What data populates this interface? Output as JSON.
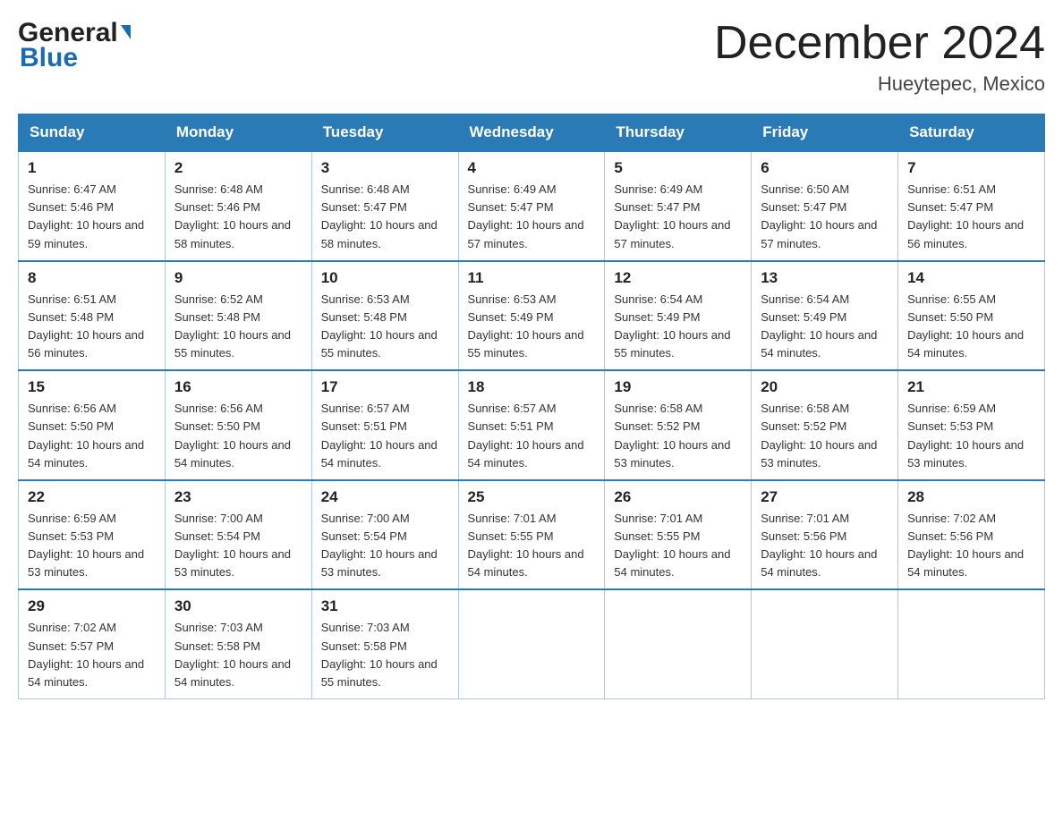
{
  "logo": {
    "general": "General",
    "blue": "Blue"
  },
  "header": {
    "title": "December 2024",
    "subtitle": "Hueytepec, Mexico"
  },
  "columns": [
    "Sunday",
    "Monday",
    "Tuesday",
    "Wednesday",
    "Thursday",
    "Friday",
    "Saturday"
  ],
  "weeks": [
    [
      {
        "day": "1",
        "sunrise": "Sunrise: 6:47 AM",
        "sunset": "Sunset: 5:46 PM",
        "daylight": "Daylight: 10 hours and 59 minutes."
      },
      {
        "day": "2",
        "sunrise": "Sunrise: 6:48 AM",
        "sunset": "Sunset: 5:46 PM",
        "daylight": "Daylight: 10 hours and 58 minutes."
      },
      {
        "day": "3",
        "sunrise": "Sunrise: 6:48 AM",
        "sunset": "Sunset: 5:47 PM",
        "daylight": "Daylight: 10 hours and 58 minutes."
      },
      {
        "day": "4",
        "sunrise": "Sunrise: 6:49 AM",
        "sunset": "Sunset: 5:47 PM",
        "daylight": "Daylight: 10 hours and 57 minutes."
      },
      {
        "day": "5",
        "sunrise": "Sunrise: 6:49 AM",
        "sunset": "Sunset: 5:47 PM",
        "daylight": "Daylight: 10 hours and 57 minutes."
      },
      {
        "day": "6",
        "sunrise": "Sunrise: 6:50 AM",
        "sunset": "Sunset: 5:47 PM",
        "daylight": "Daylight: 10 hours and 57 minutes."
      },
      {
        "day": "7",
        "sunrise": "Sunrise: 6:51 AM",
        "sunset": "Sunset: 5:47 PM",
        "daylight": "Daylight: 10 hours and 56 minutes."
      }
    ],
    [
      {
        "day": "8",
        "sunrise": "Sunrise: 6:51 AM",
        "sunset": "Sunset: 5:48 PM",
        "daylight": "Daylight: 10 hours and 56 minutes."
      },
      {
        "day": "9",
        "sunrise": "Sunrise: 6:52 AM",
        "sunset": "Sunset: 5:48 PM",
        "daylight": "Daylight: 10 hours and 55 minutes."
      },
      {
        "day": "10",
        "sunrise": "Sunrise: 6:53 AM",
        "sunset": "Sunset: 5:48 PM",
        "daylight": "Daylight: 10 hours and 55 minutes."
      },
      {
        "day": "11",
        "sunrise": "Sunrise: 6:53 AM",
        "sunset": "Sunset: 5:49 PM",
        "daylight": "Daylight: 10 hours and 55 minutes."
      },
      {
        "day": "12",
        "sunrise": "Sunrise: 6:54 AM",
        "sunset": "Sunset: 5:49 PM",
        "daylight": "Daylight: 10 hours and 55 minutes."
      },
      {
        "day": "13",
        "sunrise": "Sunrise: 6:54 AM",
        "sunset": "Sunset: 5:49 PM",
        "daylight": "Daylight: 10 hours and 54 minutes."
      },
      {
        "day": "14",
        "sunrise": "Sunrise: 6:55 AM",
        "sunset": "Sunset: 5:50 PM",
        "daylight": "Daylight: 10 hours and 54 minutes."
      }
    ],
    [
      {
        "day": "15",
        "sunrise": "Sunrise: 6:56 AM",
        "sunset": "Sunset: 5:50 PM",
        "daylight": "Daylight: 10 hours and 54 minutes."
      },
      {
        "day": "16",
        "sunrise": "Sunrise: 6:56 AM",
        "sunset": "Sunset: 5:50 PM",
        "daylight": "Daylight: 10 hours and 54 minutes."
      },
      {
        "day": "17",
        "sunrise": "Sunrise: 6:57 AM",
        "sunset": "Sunset: 5:51 PM",
        "daylight": "Daylight: 10 hours and 54 minutes."
      },
      {
        "day": "18",
        "sunrise": "Sunrise: 6:57 AM",
        "sunset": "Sunset: 5:51 PM",
        "daylight": "Daylight: 10 hours and 54 minutes."
      },
      {
        "day": "19",
        "sunrise": "Sunrise: 6:58 AM",
        "sunset": "Sunset: 5:52 PM",
        "daylight": "Daylight: 10 hours and 53 minutes."
      },
      {
        "day": "20",
        "sunrise": "Sunrise: 6:58 AM",
        "sunset": "Sunset: 5:52 PM",
        "daylight": "Daylight: 10 hours and 53 minutes."
      },
      {
        "day": "21",
        "sunrise": "Sunrise: 6:59 AM",
        "sunset": "Sunset: 5:53 PM",
        "daylight": "Daylight: 10 hours and 53 minutes."
      }
    ],
    [
      {
        "day": "22",
        "sunrise": "Sunrise: 6:59 AM",
        "sunset": "Sunset: 5:53 PM",
        "daylight": "Daylight: 10 hours and 53 minutes."
      },
      {
        "day": "23",
        "sunrise": "Sunrise: 7:00 AM",
        "sunset": "Sunset: 5:54 PM",
        "daylight": "Daylight: 10 hours and 53 minutes."
      },
      {
        "day": "24",
        "sunrise": "Sunrise: 7:00 AM",
        "sunset": "Sunset: 5:54 PM",
        "daylight": "Daylight: 10 hours and 53 minutes."
      },
      {
        "day": "25",
        "sunrise": "Sunrise: 7:01 AM",
        "sunset": "Sunset: 5:55 PM",
        "daylight": "Daylight: 10 hours and 54 minutes."
      },
      {
        "day": "26",
        "sunrise": "Sunrise: 7:01 AM",
        "sunset": "Sunset: 5:55 PM",
        "daylight": "Daylight: 10 hours and 54 minutes."
      },
      {
        "day": "27",
        "sunrise": "Sunrise: 7:01 AM",
        "sunset": "Sunset: 5:56 PM",
        "daylight": "Daylight: 10 hours and 54 minutes."
      },
      {
        "day": "28",
        "sunrise": "Sunrise: 7:02 AM",
        "sunset": "Sunset: 5:56 PM",
        "daylight": "Daylight: 10 hours and 54 minutes."
      }
    ],
    [
      {
        "day": "29",
        "sunrise": "Sunrise: 7:02 AM",
        "sunset": "Sunset: 5:57 PM",
        "daylight": "Daylight: 10 hours and 54 minutes."
      },
      {
        "day": "30",
        "sunrise": "Sunrise: 7:03 AM",
        "sunset": "Sunset: 5:58 PM",
        "daylight": "Daylight: 10 hours and 54 minutes."
      },
      {
        "day": "31",
        "sunrise": "Sunrise: 7:03 AM",
        "sunset": "Sunset: 5:58 PM",
        "daylight": "Daylight: 10 hours and 55 minutes."
      },
      null,
      null,
      null,
      null
    ]
  ]
}
